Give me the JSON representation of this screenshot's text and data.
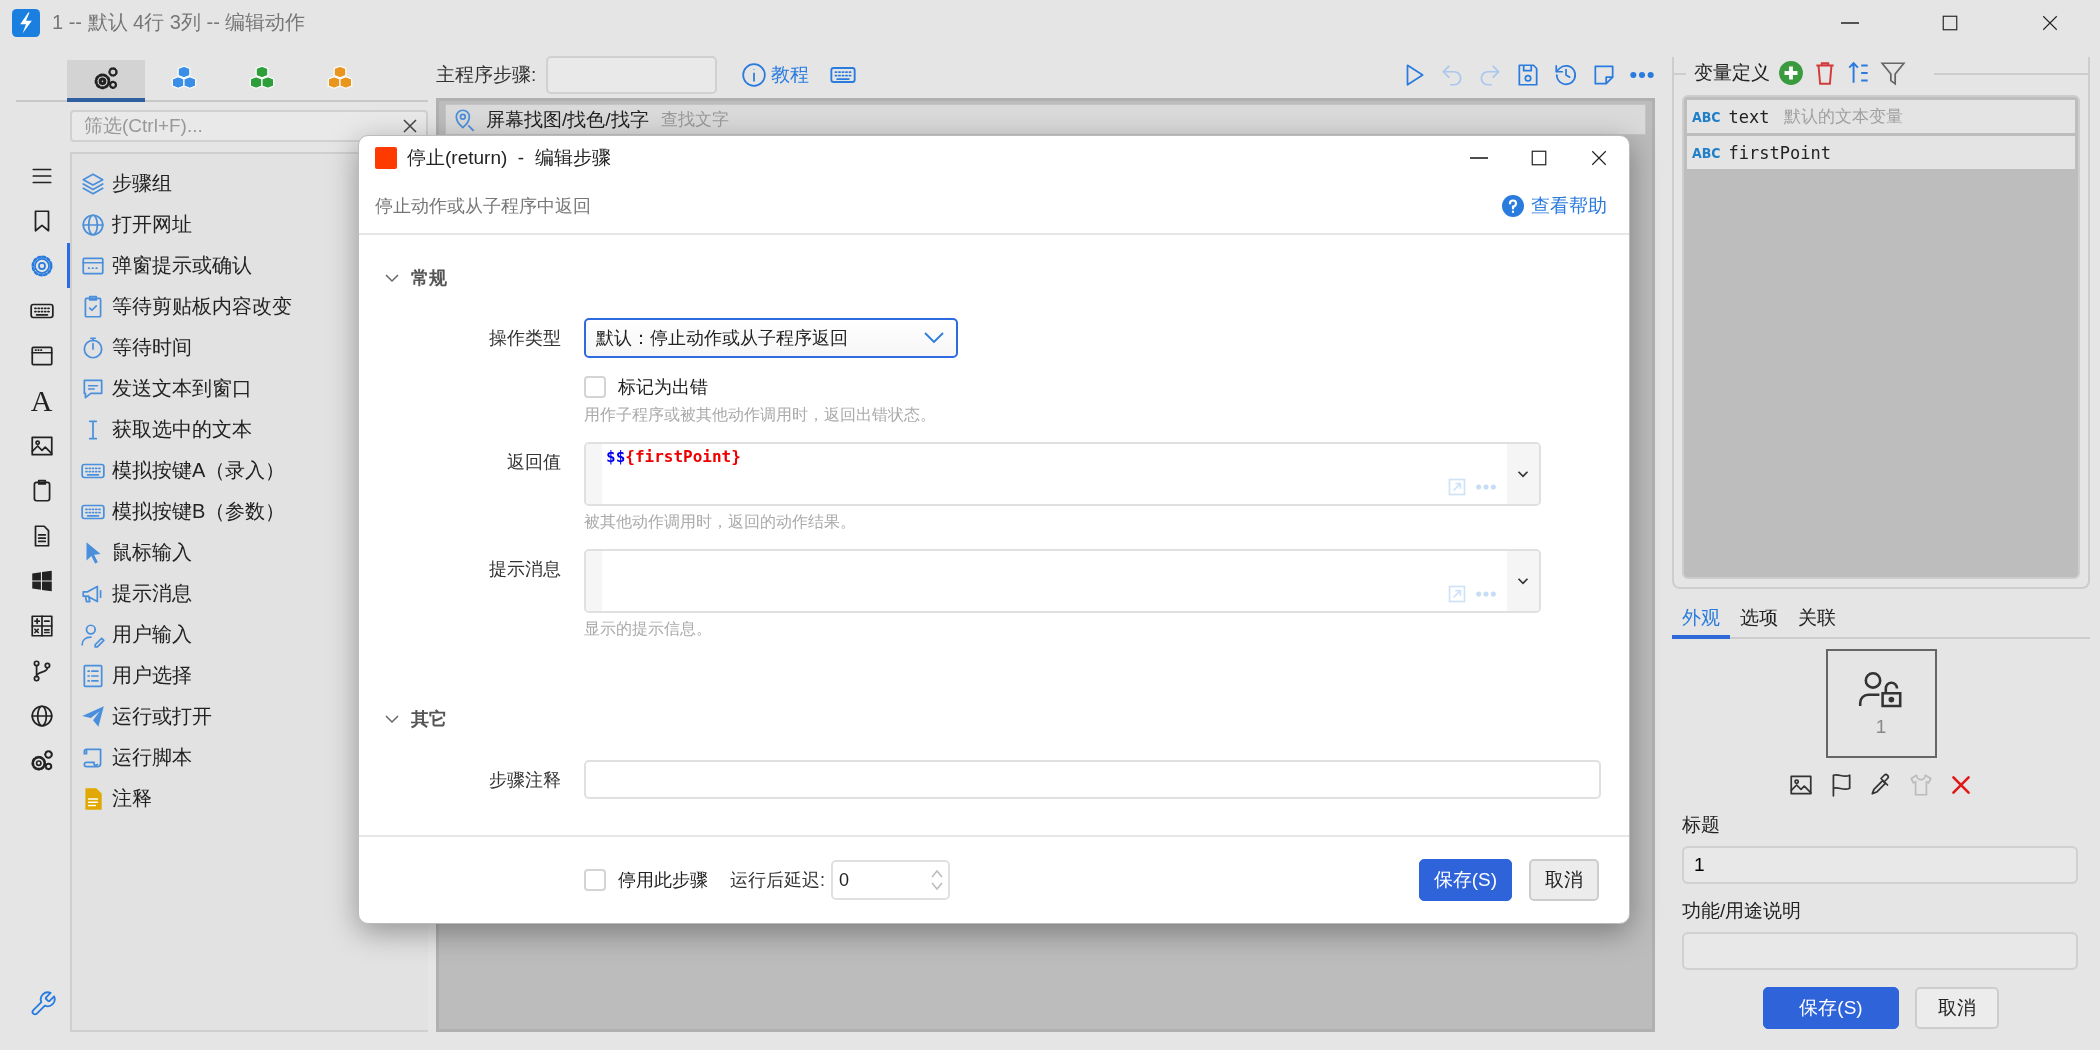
{
  "window": {
    "title": "1 -- 默认 4行 3列 -- 编辑动作"
  },
  "left_tabs": [
    {
      "kind": "gears",
      "color": "#222222",
      "selected": true
    },
    {
      "kind": "cubes",
      "color": "#3a8ee6",
      "selected": false
    },
    {
      "kind": "cubes",
      "color": "#2e9e3a",
      "selected": false
    },
    {
      "kind": "cubes",
      "color": "#e8961e",
      "selected": false
    }
  ],
  "filter": {
    "placeholder": "筛选(Ctrl+F)..."
  },
  "rail": [
    {
      "kind": "menu",
      "selected": false
    },
    {
      "kind": "bookmark",
      "selected": false
    },
    {
      "kind": "gear",
      "selected": true
    },
    {
      "kind": "keyboard",
      "selected": false
    },
    {
      "kind": "window",
      "selected": false
    },
    {
      "kind": "glyph",
      "glyph": "A",
      "selected": false
    },
    {
      "kind": "image",
      "selected": false
    },
    {
      "kind": "clipboard",
      "selected": false
    },
    {
      "kind": "document",
      "selected": false
    },
    {
      "kind": "tiles",
      "selected": false
    },
    {
      "kind": "calculator",
      "selected": false
    },
    {
      "kind": "branch",
      "selected": false
    },
    {
      "kind": "globe",
      "selected": false
    },
    {
      "kind": "gears",
      "selected": false
    }
  ],
  "actions": [
    {
      "label": "步骤组",
      "kind": "layers"
    },
    {
      "label": "打开网址",
      "kind": "globe"
    },
    {
      "label": "弹窗提示或确认",
      "kind": "popup"
    },
    {
      "label": "等待剪贴板内容改变",
      "kind": "clipcheck"
    },
    {
      "label": "等待时间",
      "kind": "stopwatch"
    },
    {
      "label": "发送文本到窗口",
      "kind": "chat"
    },
    {
      "label": "获取选中的文本",
      "kind": "cursor"
    },
    {
      "label": "模拟按键A（录入）",
      "kind": "keyboard"
    },
    {
      "label": "模拟按键B（参数）",
      "kind": "keyboard"
    },
    {
      "label": "鼠标输入",
      "kind": "pointer"
    },
    {
      "label": "提示消息",
      "kind": "megaphone"
    },
    {
      "label": "用户输入",
      "kind": "useredit"
    },
    {
      "label": "用户选择",
      "kind": "list"
    },
    {
      "label": "运行或打开",
      "kind": "plane"
    },
    {
      "label": "运行脚本",
      "kind": "scroll"
    },
    {
      "label": "注释",
      "kind": "note"
    }
  ],
  "main": {
    "label": "主程序步骤:",
    "tutorial": "教程",
    "toolbar": [
      {
        "kind": "play",
        "disabled": false
      },
      {
        "kind": "undo",
        "disabled": true
      },
      {
        "kind": "redo",
        "disabled": true
      },
      {
        "kind": "save",
        "disabled": false
      },
      {
        "kind": "history",
        "disabled": false
      },
      {
        "kind": "sticky",
        "disabled": false
      },
      {
        "kind": "more",
        "disabled": false
      }
    ],
    "steps": [
      {
        "title": "屏幕找图/找色/找字",
        "description": "查找文字"
      }
    ]
  },
  "variables": {
    "title": "变量定义",
    "items": [
      {
        "type": "ABC",
        "name": "text",
        "description": "默认的文本变量"
      },
      {
        "type": "ABC",
        "name": "firstPoint"
      }
    ]
  },
  "right_tabs": [
    {
      "label": "外观",
      "selected": true
    },
    {
      "label": "选项",
      "selected": false
    },
    {
      "label": "关联",
      "selected": false
    }
  ],
  "preview": {
    "caption": "1"
  },
  "icon_tools": [
    {
      "kind": "image",
      "disabled": false
    },
    {
      "kind": "flag",
      "disabled": false
    },
    {
      "kind": "dropper",
      "disabled": false
    },
    {
      "kind": "shirt",
      "disabled": true
    },
    {
      "kind": "delete",
      "disabled": false
    }
  ],
  "title_field": {
    "label": "标题",
    "value": "1"
  },
  "purpose_field": {
    "label": "功能/用途说明"
  },
  "buttons": [
    {
      "label": "保存(S)",
      "kind": "primary"
    },
    {
      "label": "取消",
      "kind": "secondary"
    }
  ],
  "dialog": {
    "title": "停止(return)  -  编辑步骤",
    "subtitle": "停止动作或从子程序中返回",
    "help": "查看帮助",
    "sections": [
      {
        "title": "常规",
        "expanded": true
      },
      {
        "title": "其它",
        "expanded": true
      }
    ],
    "operation": {
      "label": "操作类型",
      "value": "默认：停止动作或从子程序返回"
    },
    "mark_error": {
      "label": "标记为出错",
      "checked": false,
      "hint": "用作子程序或被其他动作调用时，返回出错状态。"
    },
    "return_value": {
      "label": "返回值",
      "tokens": [
        {
          "text": "$$",
          "kind": "prefix"
        },
        {
          "text": "{firstPoint}",
          "kind": "variable"
        }
      ],
      "hint": "被其他动作调用时，返回的动作结果。"
    },
    "message": {
      "label": "提示消息",
      "hint": "显示的提示信息。"
    },
    "note": {
      "label": "步骤注释"
    },
    "disable": {
      "label": "停用此步骤",
      "checked": false
    },
    "delay": {
      "label": "运行后延迟:",
      "value": "0"
    },
    "buttons": [
      {
        "label": "保存(S)",
        "kind": "primary"
      },
      {
        "label": "取消",
        "kind": "secondary"
      }
    ]
  }
}
